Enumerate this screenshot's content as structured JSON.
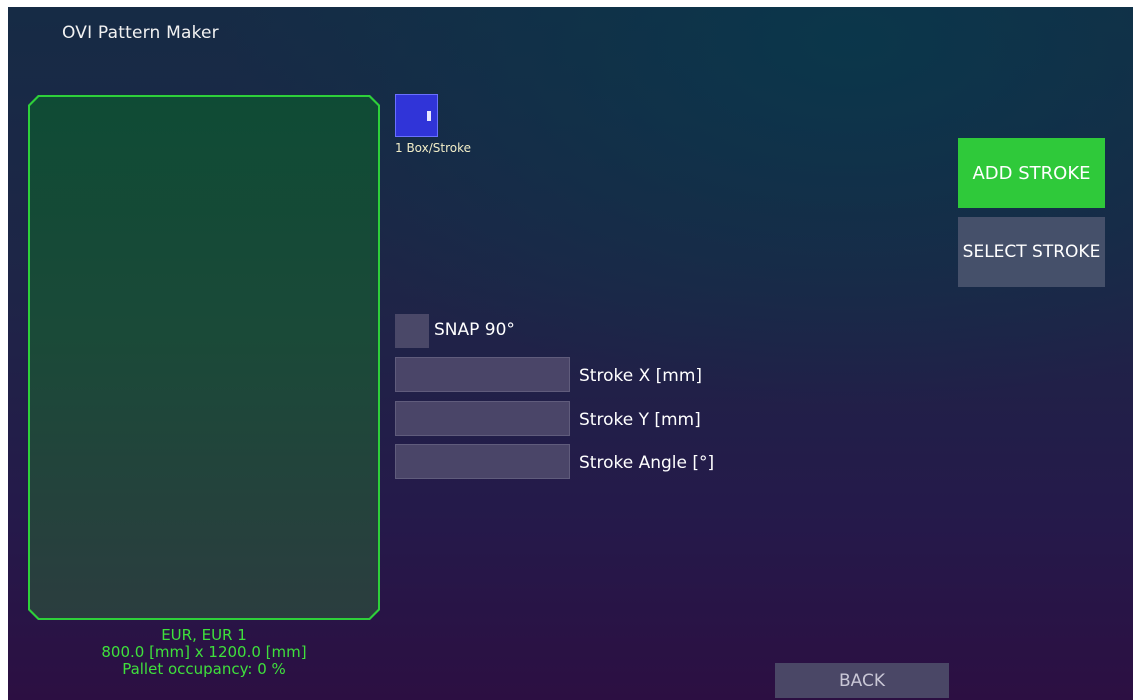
{
  "app": {
    "title": "OVI Pattern Maker"
  },
  "pallet": {
    "name": "EUR, EUR 1",
    "dimensions": "800.0 [mm] x 1200.0 [mm]",
    "occupancy": "Pallet occupancy: 0 %",
    "outline_color": "#2ed03a",
    "fill_color": "#1a4a38"
  },
  "stroke_type": {
    "caption": "1 Box/Stroke",
    "color": "#3034d8"
  },
  "buttons": {
    "add_stroke": "ADD STROKE",
    "select_stroke": "SELECT STROKE",
    "back": "BACK"
  },
  "snap": {
    "label": "SNAP 90°",
    "checked": false
  },
  "fields": {
    "stroke_x": {
      "label": "Stroke X [mm]",
      "value": ""
    },
    "stroke_y": {
      "label": "Stroke Y [mm]",
      "value": ""
    },
    "stroke_angle": {
      "label": "Stroke Angle [°]",
      "value": ""
    }
  },
  "colors": {
    "accent_green": "#2fc93a",
    "button_gray": "#45506a",
    "input_bg": "#4a4568",
    "info_text": "#3fe03c"
  }
}
